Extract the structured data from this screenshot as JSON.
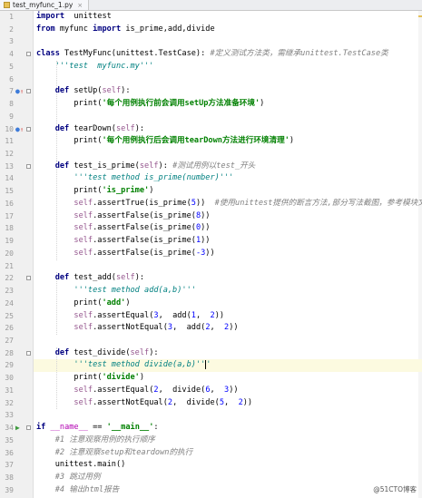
{
  "tab": {
    "title": "test_myfunc_1.py",
    "close": "×",
    "icon": "python-file-icon"
  },
  "watermark": "@51CTO博客",
  "colors": {
    "keyword": "#000080",
    "string": "#008000",
    "docstring": "#008080",
    "comment": "#808080",
    "self": "#94558d",
    "number": "#0000ff",
    "gutter": "#f0f0f0",
    "current_line": "#fcfae0"
  },
  "current_line": 29,
  "gutter_markers": {
    "override_up_icon": "o↑",
    "run_icon": "▶"
  },
  "lines": [
    [
      {
        "t": "import",
        "c": "kw"
      },
      {
        "t": "  unittest"
      }
    ],
    [
      {
        "t": "from",
        "c": "kw"
      },
      {
        "t": " myfunc "
      },
      {
        "t": "import",
        "c": "kw"
      },
      {
        "t": " is_prime,add,divide"
      }
    ],
    [],
    [
      {
        "t": "class",
        "c": "kw"
      },
      {
        "t": " TestMyFunc(unittest.TestCase): "
      },
      {
        "t": "#定义测试方法类，需继承unittest.TestCase类",
        "c": "com"
      }
    ],
    [
      {
        "t": "    "
      },
      {
        "t": "'''test  myfunc.my'''",
        "c": "doc"
      }
    ],
    [],
    [
      {
        "t": "    "
      },
      {
        "t": "def",
        "c": "kw"
      },
      {
        "t": " setUp("
      },
      {
        "t": "self",
        "c": "slf"
      },
      {
        "t": "):"
      }
    ],
    [
      {
        "t": "        print("
      },
      {
        "t": "'每个用例执行前会调用setUp方法准备环境'",
        "c": "str"
      },
      {
        "t": ")"
      }
    ],
    [],
    [
      {
        "t": "    "
      },
      {
        "t": "def",
        "c": "kw"
      },
      {
        "t": " tearDown("
      },
      {
        "t": "self",
        "c": "slf"
      },
      {
        "t": "):"
      }
    ],
    [
      {
        "t": "        print("
      },
      {
        "t": "'每个用例执行后会调用tearDown方法进行环境清理'",
        "c": "str"
      },
      {
        "t": ")"
      }
    ],
    [],
    [
      {
        "t": "    "
      },
      {
        "t": "def",
        "c": "kw"
      },
      {
        "t": " test_is_prime("
      },
      {
        "t": "self",
        "c": "slf"
      },
      {
        "t": "): "
      },
      {
        "t": "#测试用例以test_开头",
        "c": "com"
      }
    ],
    [
      {
        "t": "        "
      },
      {
        "t": "'''test method is_prime(number)'''",
        "c": "doc"
      }
    ],
    [
      {
        "t": "        print("
      },
      {
        "t": "'is_prime'",
        "c": "str"
      },
      {
        "t": ")"
      }
    ],
    [
      {
        "t": "        "
      },
      {
        "t": "self",
        "c": "slf"
      },
      {
        "t": ".assertTrue(is_prime("
      },
      {
        "t": "5",
        "c": "num"
      },
      {
        "t": "))  "
      },
      {
        "t": "#使用unittest提供的断言方法,部分写法截图，参考模块文档",
        "c": "com"
      }
    ],
    [
      {
        "t": "        "
      },
      {
        "t": "self",
        "c": "slf"
      },
      {
        "t": ".assertFalse(is_prime("
      },
      {
        "t": "8",
        "c": "num"
      },
      {
        "t": "))"
      }
    ],
    [
      {
        "t": "        "
      },
      {
        "t": "self",
        "c": "slf"
      },
      {
        "t": ".assertFalse(is_prime("
      },
      {
        "t": "0",
        "c": "num"
      },
      {
        "t": "))"
      }
    ],
    [
      {
        "t": "        "
      },
      {
        "t": "self",
        "c": "slf"
      },
      {
        "t": ".assertFalse(is_prime("
      },
      {
        "t": "1",
        "c": "num"
      },
      {
        "t": "))"
      }
    ],
    [
      {
        "t": "        "
      },
      {
        "t": "self",
        "c": "slf"
      },
      {
        "t": ".assertFalse(is_prime("
      },
      {
        "t": "-3",
        "c": "num"
      },
      {
        "t": "))"
      }
    ],
    [],
    [
      {
        "t": "    "
      },
      {
        "t": "def",
        "c": "kw"
      },
      {
        "t": " test_add("
      },
      {
        "t": "self",
        "c": "slf"
      },
      {
        "t": "):"
      }
    ],
    [
      {
        "t": "        "
      },
      {
        "t": "'''test method add(a,b)'''",
        "c": "doc"
      }
    ],
    [
      {
        "t": "        print("
      },
      {
        "t": "'add'",
        "c": "str"
      },
      {
        "t": ")"
      }
    ],
    [
      {
        "t": "        "
      },
      {
        "t": "self",
        "c": "slf"
      },
      {
        "t": ".assertEqual("
      },
      {
        "t": "3",
        "c": "num"
      },
      {
        "t": ",  add("
      },
      {
        "t": "1",
        "c": "num"
      },
      {
        "t": ",  "
      },
      {
        "t": "2",
        "c": "num"
      },
      {
        "t": "))"
      }
    ],
    [
      {
        "t": "        "
      },
      {
        "t": "self",
        "c": "slf"
      },
      {
        "t": ".assertNotEqual("
      },
      {
        "t": "3",
        "c": "num"
      },
      {
        "t": ",  add("
      },
      {
        "t": "2",
        "c": "num"
      },
      {
        "t": ",  "
      },
      {
        "t": "2",
        "c": "num"
      },
      {
        "t": "))"
      }
    ],
    [],
    [
      {
        "t": "    "
      },
      {
        "t": "def",
        "c": "kw"
      },
      {
        "t": " test_divide("
      },
      {
        "t": "self",
        "c": "slf"
      },
      {
        "t": "):"
      }
    ],
    [
      {
        "t": "        "
      },
      {
        "t": "'''test method divide(a,b)''",
        "c": "doc"
      },
      {
        "t": "CARET"
      },
      {
        "t": "'",
        "c": "doc"
      }
    ],
    [
      {
        "t": "        print("
      },
      {
        "t": "'divide'",
        "c": "str"
      },
      {
        "t": ")"
      }
    ],
    [
      {
        "t": "        "
      },
      {
        "t": "self",
        "c": "slf"
      },
      {
        "t": ".assertEqual("
      },
      {
        "t": "2",
        "c": "num"
      },
      {
        "t": ",  divide("
      },
      {
        "t": "6",
        "c": "num"
      },
      {
        "t": ",  "
      },
      {
        "t": "3",
        "c": "num"
      },
      {
        "t": "))"
      }
    ],
    [
      {
        "t": "        "
      },
      {
        "t": "self",
        "c": "slf"
      },
      {
        "t": ".assertNotEqual("
      },
      {
        "t": "2",
        "c": "num"
      },
      {
        "t": ",  divide("
      },
      {
        "t": "5",
        "c": "num"
      },
      {
        "t": ",  "
      },
      {
        "t": "2",
        "c": "num"
      },
      {
        "t": "))"
      }
    ],
    [],
    [
      {
        "t": "if",
        "c": "kw"
      },
      {
        "t": " "
      },
      {
        "t": "__name__",
        "c": "dnd"
      },
      {
        "t": " == "
      },
      {
        "t": "'__main__'",
        "c": "str"
      },
      {
        "t": ":"
      }
    ],
    [
      {
        "t": "    "
      },
      {
        "t": "#1 注意观察用例的执行顺序",
        "c": "com"
      }
    ],
    [
      {
        "t": "    "
      },
      {
        "t": "#2 注意观察setup和teardown的执行",
        "c": "com"
      }
    ],
    [
      {
        "t": "    unittest.main()"
      }
    ],
    [
      {
        "t": "    "
      },
      {
        "t": "#3 跳过用例",
        "c": "com"
      }
    ],
    [
      {
        "t": "    "
      },
      {
        "t": "#4 输出html报告",
        "c": "com"
      }
    ]
  ]
}
